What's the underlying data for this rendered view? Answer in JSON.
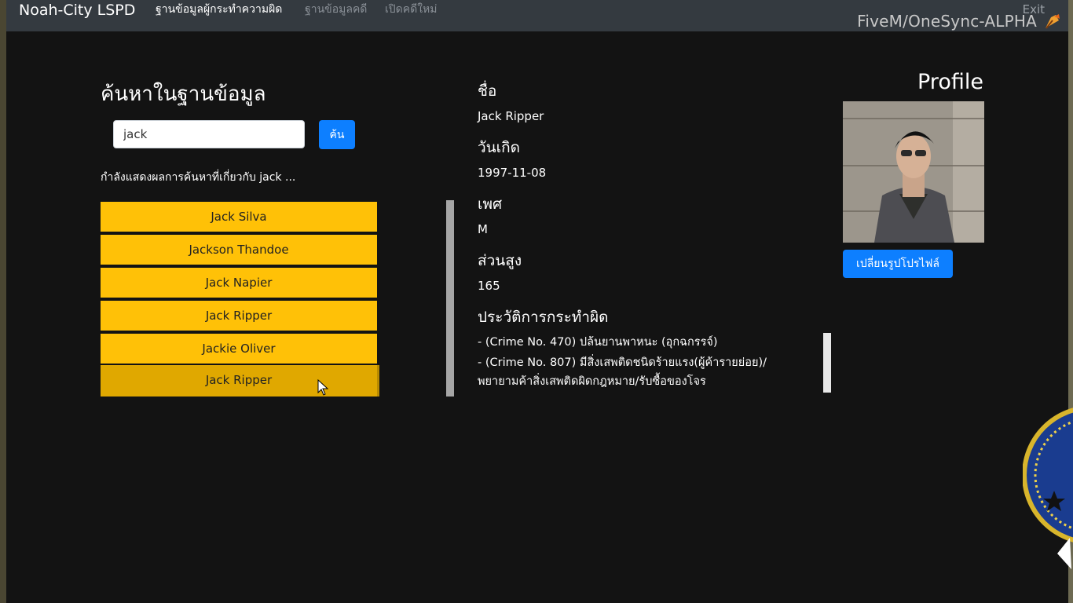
{
  "navbar": {
    "brand": "Noah-City LSPD",
    "links": [
      "ฐานข้อมูลผู้กระทำความผิด",
      "ฐานข้อมูลคดี",
      "เปิดคดีใหม่"
    ],
    "exit": "Exit",
    "client_label": "FiveM/OneSync-ALPHA"
  },
  "search": {
    "title": "ค้นหาในฐานข้อมูล",
    "query": "jack",
    "button": "ค้น",
    "caption": "กำลังแสดงผลการค้นหาที่เกี่ยวกับ jack ..."
  },
  "results": [
    "Jack Silva",
    "Jackson Thandoe",
    "Jack Napier",
    "Jack Ripper",
    "Jackie Oliver",
    "Jack Ripper"
  ],
  "details": {
    "name_label": "ชื่อ",
    "name": "Jack Ripper",
    "dob_label": "วันเกิด",
    "dob": "1997-11-08",
    "sex_label": "เพศ",
    "sex": "M",
    "height_label": "ส่วนสูง",
    "height": "165",
    "history_label": "ประวัติการกระทำผิด",
    "history": [
      "- (Crime No. 470) ปล้นยานพาหนะ (อุกฉกรรจ์)",
      "- (Crime No. 807) มีสิ่งเสพติดชนิดร้ายแรง(ผู้ค้ารายย่อย)/",
      "พยายามค้าสิ่งเสพติดผิดกฎหมาย/รับซื้อของโจร"
    ]
  },
  "profile": {
    "title": "Profile",
    "change_button": "เปลี่ยนรูปโปรไฟล์"
  },
  "colors": {
    "background": "#131313",
    "navbar": "#343a40",
    "result_item": "#ffc107",
    "primary_button": "#0d7fff"
  }
}
